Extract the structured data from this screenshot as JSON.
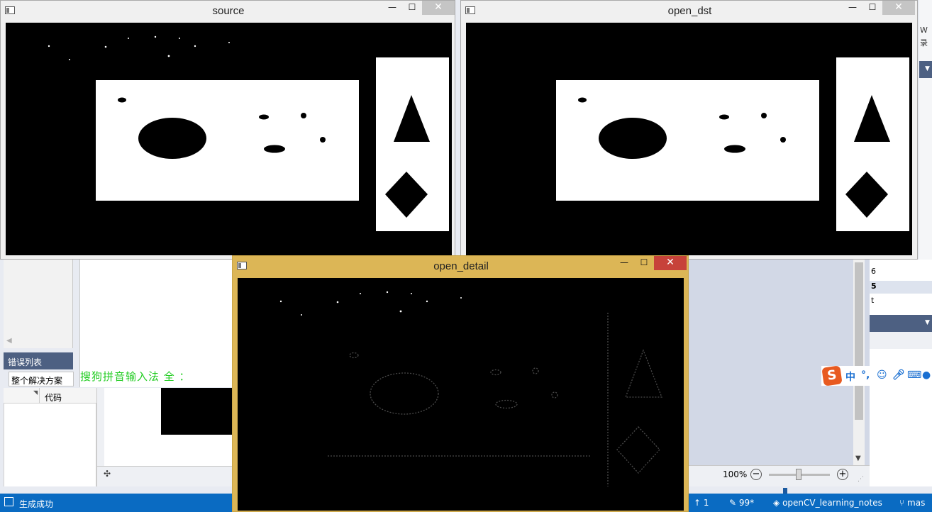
{
  "ide": {
    "error_list_title": "错误列表",
    "solution_filter": "整个解决方案",
    "ime_status": "搜狗拼音输入法 全 ：",
    "column_code": "代码",
    "zoom_level": "100%",
    "zoom_minus": "−",
    "zoom_plus": "+",
    "right_glyphs": [
      "6",
      "5",
      "t"
    ],
    "right_top_glyphs": [
      "W",
      "录"
    ],
    "move_icon": "✣"
  },
  "status_bar": {
    "build_status": "生成成功",
    "changes_count": "1",
    "pending_edits": "99*",
    "repository": "openCV_learning_notes",
    "branch": "mas"
  },
  "ime_toolbar": {
    "logo": "S",
    "mode": "中",
    "punct": "°,"
  },
  "windows": {
    "source": {
      "title": "source",
      "minimize": "—",
      "maximize": "☐",
      "close": "✕"
    },
    "open_dst": {
      "title": "open_dst",
      "minimize": "—",
      "maximize": "☐",
      "close": "✕"
    },
    "open_detail": {
      "title": "open_detail",
      "minimize": "—",
      "maximize": "☐",
      "close": "✕"
    }
  },
  "colors": {
    "status_bar": "#0a6bc2",
    "active_frame": "#dcb656",
    "close_active": "#c7423a",
    "ime_text": "#22cc22"
  }
}
